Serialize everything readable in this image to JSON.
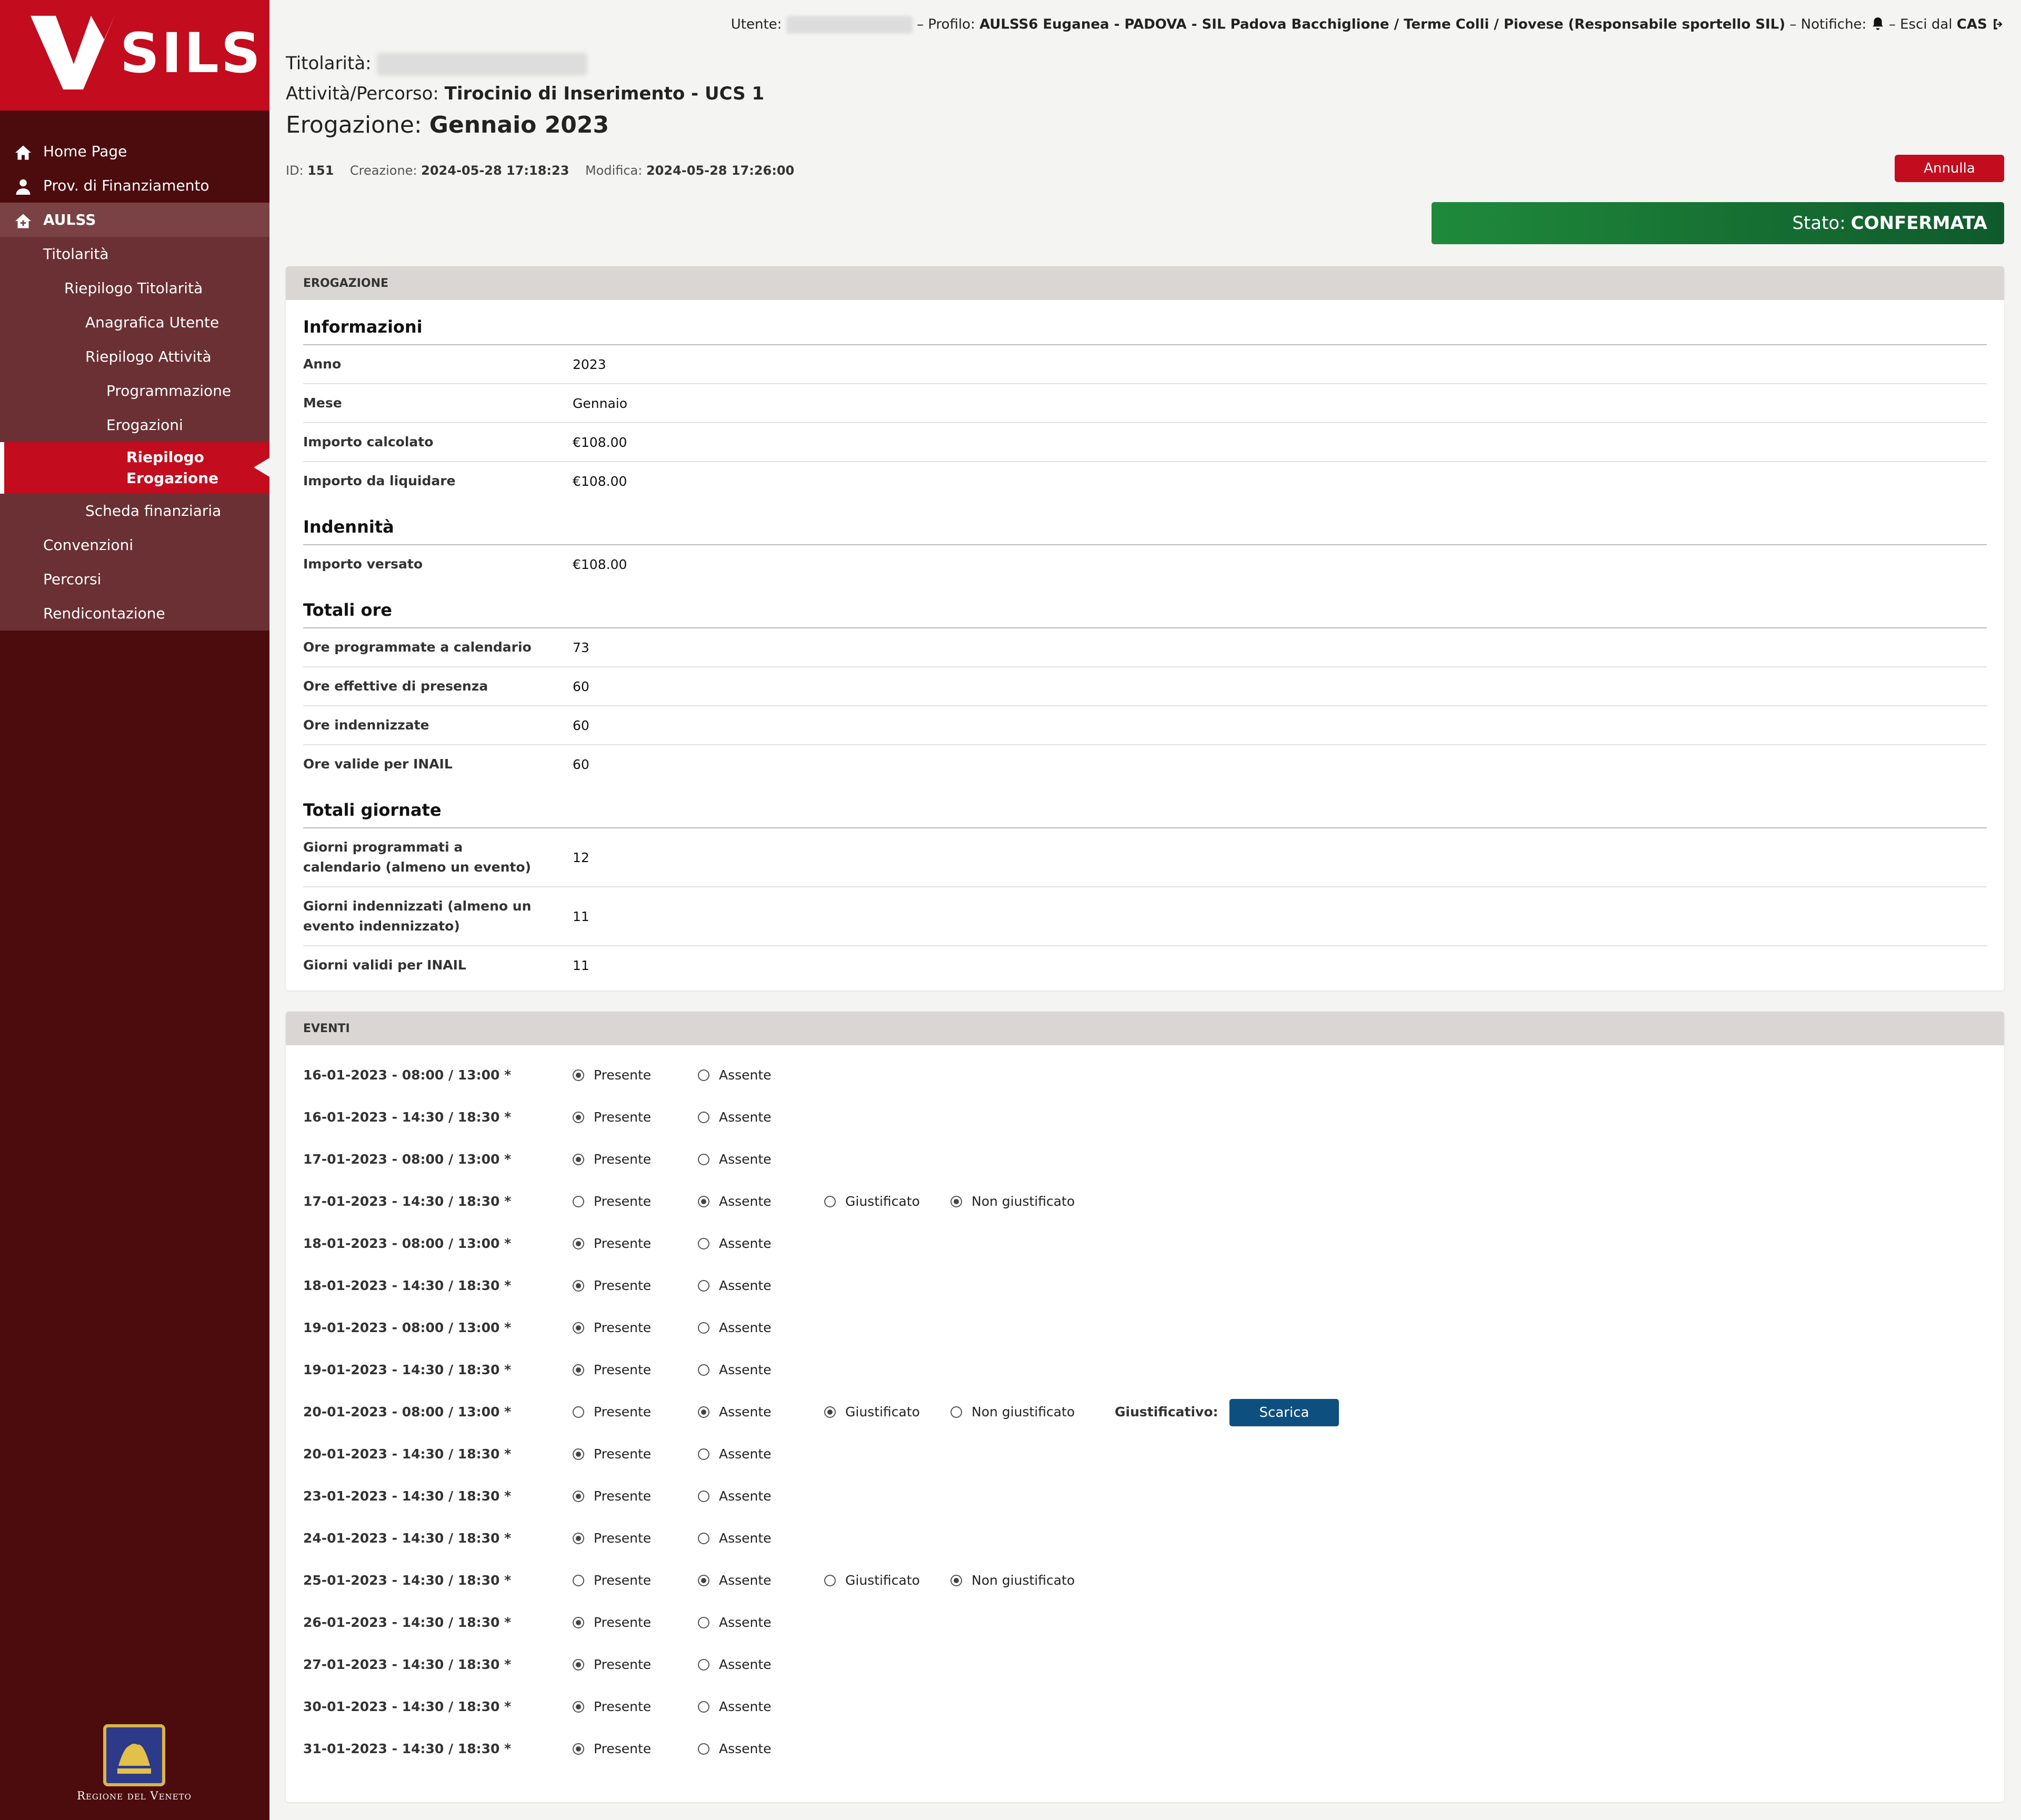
{
  "sidebar": {
    "logo_text": "SILS",
    "nav": [
      {
        "label": "Home Page",
        "icon": "home-icon"
      },
      {
        "label": "Prov. di Finanziamento",
        "icon": "user-icon"
      },
      {
        "label": "AULSS",
        "icon": "house-plus-icon"
      },
      {
        "label": "Titolarità"
      },
      {
        "label": "Riepilogo Titolarità"
      },
      {
        "label": "Anagrafica Utente"
      },
      {
        "label": "Riepilogo Attività"
      },
      {
        "label": "Programmazione"
      },
      {
        "label": "Erogazioni"
      },
      {
        "label": "Riepilogo Erogazione"
      },
      {
        "label": "Scheda finanziaria"
      },
      {
        "label": "Convenzioni"
      },
      {
        "label": "Percorsi"
      },
      {
        "label": "Rendicontazione"
      }
    ],
    "region_text": "Regione del Veneto"
  },
  "header": {
    "utente_label": "Utente:",
    "profilo_label": "Profilo:",
    "profilo_value": "AULSS6 Euganea - PADOVA - SIL Padova Bacchiglione / Terme Colli / Piovese (Responsabile sportello SIL)",
    "notifiche_label": "Notifiche:",
    "esci_label": "Esci dal",
    "esci_value": "CAS",
    "sep": "–"
  },
  "title": {
    "titolarita_label": "Titolarità:",
    "attivita_label": "Attività/Percorso:",
    "attivita_value": "Tirocinio di Inserimento - UCS 1",
    "erogazione_label": "Erogazione:",
    "erogazione_value": "Gennaio 2023"
  },
  "meta": {
    "id_label": "ID:",
    "id_value": "151",
    "creazione_label": "Creazione:",
    "creazione_value": "2024-05-28 17:18:23",
    "modifica_label": "Modifica:",
    "modifica_value": "2024-05-28 17:26:00"
  },
  "annulla_label": "Annulla",
  "stato": {
    "label": "Stato:",
    "value": "CONFERMATA"
  },
  "erogazione_panel": {
    "heading": "EROGAZIONE",
    "informazioni_title": "Informazioni",
    "informazioni": [
      {
        "k": "Anno",
        "v": "2023"
      },
      {
        "k": "Mese",
        "v": "Gennaio"
      },
      {
        "k": "Importo calcolato",
        "v": "€108.00"
      },
      {
        "k": "Importo da liquidare",
        "v": "€108.00"
      }
    ],
    "indennita_title": "Indennità",
    "indennita": [
      {
        "k": "Importo versato",
        "v": "€108.00"
      }
    ],
    "totali_ore_title": "Totali ore",
    "totali_ore": [
      {
        "k": "Ore programmate a calendario",
        "v": "73"
      },
      {
        "k": "Ore effettive di presenza",
        "v": "60"
      },
      {
        "k": "Ore indennizzate",
        "v": "60"
      },
      {
        "k": "Ore valide per INAIL",
        "v": "60"
      }
    ],
    "totali_giornate_title": "Totali giornate",
    "totali_giornate": [
      {
        "k": "Giorni programmati a calendario (almeno un evento)",
        "v": "12"
      },
      {
        "k": "Giorni indennizzati (almeno un evento indennizzato)",
        "v": "11"
      },
      {
        "k": "Giorni validi per INAIL",
        "v": "11"
      }
    ]
  },
  "eventi_panel": {
    "heading": "EVENTI",
    "labels": {
      "presente": "Presente",
      "assente": "Assente",
      "giustificato": "Giustificato",
      "non_giustificato": "Non giustificato",
      "giustificativo": "Giustificativo:",
      "scarica": "Scarica"
    },
    "events": [
      {
        "date": "16-01-2023 - 08:00 / 13:00 *",
        "status": "presente"
      },
      {
        "date": "16-01-2023 - 14:30 / 18:30 *",
        "status": "presente"
      },
      {
        "date": "17-01-2023 - 08:00 / 13:00 *",
        "status": "presente"
      },
      {
        "date": "17-01-2023 - 14:30 / 18:30 *",
        "status": "assente",
        "giust": "non_giustificato"
      },
      {
        "date": "18-01-2023 - 08:00 / 13:00 *",
        "status": "presente"
      },
      {
        "date": "18-01-2023 - 14:30 / 18:30 *",
        "status": "presente"
      },
      {
        "date": "19-01-2023 - 08:00 / 13:00 *",
        "status": "presente"
      },
      {
        "date": "19-01-2023 - 14:30 / 18:30 *",
        "status": "presente"
      },
      {
        "date": "20-01-2023 - 08:00 / 13:00 *",
        "status": "assente",
        "giust": "giustificato",
        "scarica": true
      },
      {
        "date": "20-01-2023 - 14:30 / 18:30 *",
        "status": "presente"
      },
      {
        "date": "23-01-2023 - 14:30 / 18:30 *",
        "status": "presente"
      },
      {
        "date": "24-01-2023 - 14:30 / 18:30 *",
        "status": "presente"
      },
      {
        "date": "25-01-2023 - 14:30 / 18:30 *",
        "status": "assente",
        "giust": "non_giustificato"
      },
      {
        "date": "26-01-2023 - 14:30 / 18:30 *",
        "status": "presente"
      },
      {
        "date": "27-01-2023 - 14:30 / 18:30 *",
        "status": "presente"
      },
      {
        "date": "30-01-2023 - 14:30 / 18:30 *",
        "status": "presente"
      },
      {
        "date": "31-01-2023 - 14:30 / 18:30 *",
        "status": "presente"
      }
    ]
  },
  "colors": {
    "brand_red": "#c30c1e",
    "sidebar_bg": "#4c0c0e",
    "status_green": "#1f8a3b",
    "download_blue": "#0d5080"
  }
}
